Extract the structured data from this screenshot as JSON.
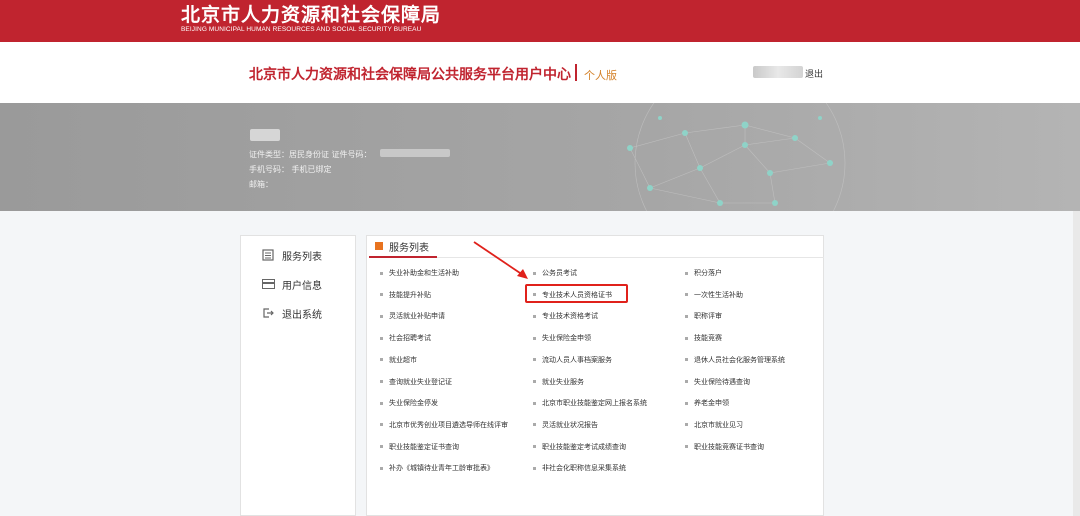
{
  "bureau": {
    "name_cn": "北京市人力资源和社会保障局",
    "name_en": "BEIJING MUNICIPAL HUMAN RESOURCES AND SOCIAL SECURITY BUREAU"
  },
  "header": {
    "title": "北京市人力资源和社会保障局公共服务平台用户中心",
    "edition": "个人版",
    "logout_label": "退出"
  },
  "profile": {
    "id_line": "证件类型：居民身份证  证件号码：",
    "phone_line": "手机号码：   手机已绑定",
    "email_line": "邮箱："
  },
  "sidebar": {
    "items": [
      {
        "label": "服务列表",
        "icon": "list-icon"
      },
      {
        "label": "用户信息",
        "icon": "card-icon"
      },
      {
        "label": "退出系统",
        "icon": "exit-icon"
      }
    ]
  },
  "services": {
    "tab_label": "服务列表",
    "col1": [
      "失业补助金和生活补助",
      "技能提升补贴",
      "灵活就业补贴申请",
      "社会招聘考试",
      "就业超市",
      "查询就业失业登记证",
      "失业保险金停发",
      "北京市优秀创业项目遴选导师在线评审",
      "职业技能鉴定证书查询",
      "补办《城镇待业青年工龄审批表》"
    ],
    "col2": [
      "公务员考试",
      "专业技术人员资格证书",
      "专业技术资格考试",
      "失业保险金申领",
      "流动人员人事档案服务",
      "就业失业服务",
      "北京市职业技能鉴定网上报名系统",
      "灵活就业状况报告",
      "职业技能鉴定考试成绩查询",
      "非社会化职称信息采集系统"
    ],
    "col3": [
      "积分落户",
      "一次性生活补助",
      "职称评审",
      "技能竞赛",
      "退休人员社会化服务管理系统",
      "失业保险待遇查询",
      "养老金申领",
      "北京市就业见习",
      "职业技能竞赛证书查询"
    ],
    "highlighted": "专业技术人员资格证书"
  },
  "colors": {
    "brand": "#c0242f",
    "edition": "#d4822a",
    "highlight": "#e0211b"
  }
}
